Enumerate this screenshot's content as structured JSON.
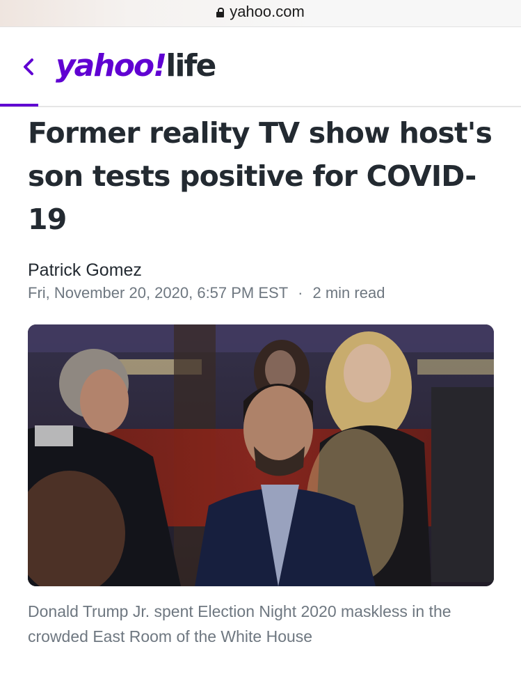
{
  "browser": {
    "url": "yahoo.com",
    "lock_icon": "lock-icon"
  },
  "header": {
    "back_icon": "chevron-left-icon",
    "logo_brand": "yahoo",
    "logo_bang": "!",
    "logo_section": "life",
    "accent_color": "#6001d2"
  },
  "article": {
    "headline": "Former reality TV show host's son tests positive for COVID-19",
    "author": "Patrick Gomez",
    "date": "Fri, November 20, 2020, 6:57 PM EST",
    "separator": "·",
    "read_time": "2 min read",
    "caption": "Donald Trump Jr. spent Election Night 2020 maskless in the crowded East Room of the White House"
  }
}
